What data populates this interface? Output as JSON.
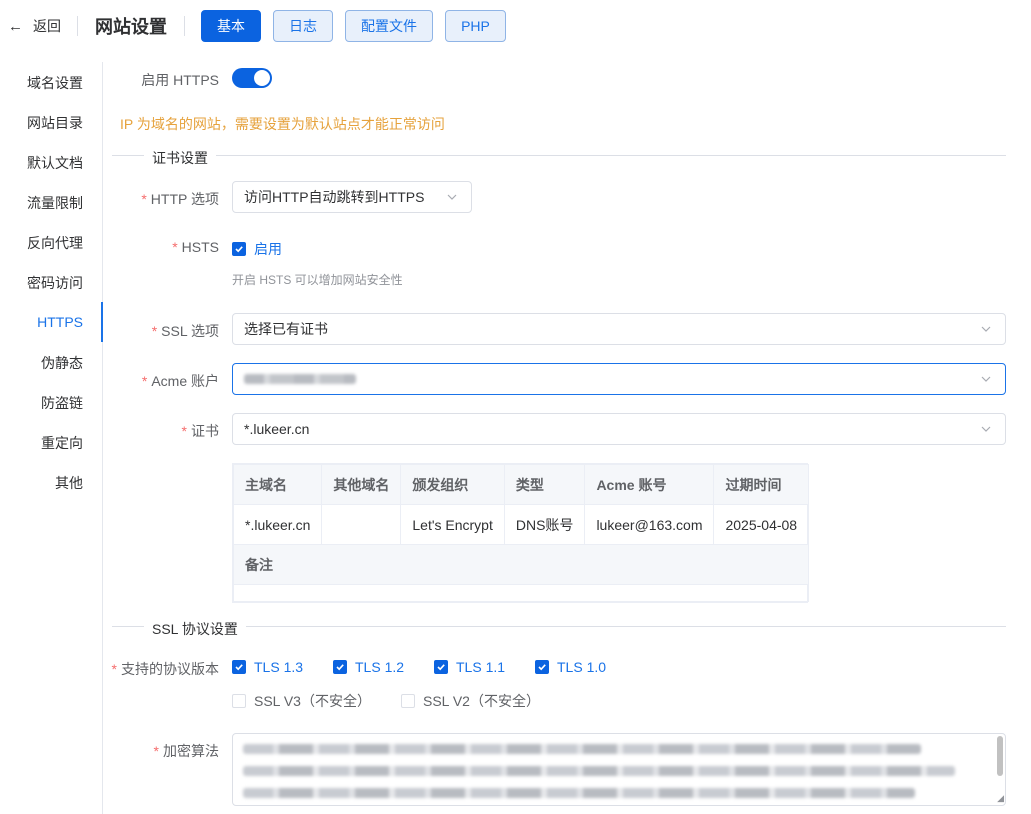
{
  "header": {
    "back_label": "返回",
    "title": "网站设置",
    "tabs": [
      {
        "label": "基本",
        "active": true
      },
      {
        "label": "日志",
        "active": false
      },
      {
        "label": "配置文件",
        "active": false
      },
      {
        "label": "PHP",
        "active": false
      }
    ]
  },
  "sidebar": {
    "items": [
      {
        "label": "域名设置"
      },
      {
        "label": "网站目录"
      },
      {
        "label": "默认文档"
      },
      {
        "label": "流量限制"
      },
      {
        "label": "反向代理"
      },
      {
        "label": "密码访问"
      },
      {
        "label": "HTTPS",
        "active": true
      },
      {
        "label": "伪静态"
      },
      {
        "label": "防盗链"
      },
      {
        "label": "重定向"
      },
      {
        "label": "其他"
      }
    ]
  },
  "https": {
    "enable_label": "启用 HTTPS",
    "enabled": true,
    "warning": "IP 为域名的网站，需要设置为默认站点才能正常访问"
  },
  "cert_section": {
    "title": "证书设置",
    "http_option": {
      "label": "HTTP 选项",
      "value": "访问HTTP自动跳转到HTTPS"
    },
    "hsts": {
      "label": "HSTS",
      "checkbox_label": "启用",
      "checked": true,
      "hint": "开启 HSTS 可以增加网站安全性"
    },
    "ssl_option": {
      "label": "SSL 选项",
      "value": "选择已有证书"
    },
    "acme_account": {
      "label": "Acme 账户"
    },
    "cert": {
      "label": "证书",
      "value": "*.lukeer.cn"
    },
    "table": {
      "headers": [
        "主域名",
        "其他域名",
        "颁发组织",
        "类型",
        "Acme 账号",
        "过期时间"
      ],
      "row": [
        "*.lukeer.cn",
        "",
        "Let's Encrypt",
        "DNS账号",
        "lukeer@163.com",
        "2025-04-08"
      ],
      "note_label": "备注"
    }
  },
  "ssl_section": {
    "title": "SSL 协议设置",
    "protocols_label": "支持的协议版本",
    "protocols": [
      {
        "label": "TLS 1.3",
        "checked": true
      },
      {
        "label": "TLS 1.2",
        "checked": true
      },
      {
        "label": "TLS 1.1",
        "checked": true
      },
      {
        "label": "TLS 1.0",
        "checked": true
      },
      {
        "label": "SSL V3（不安全）",
        "checked": false
      },
      {
        "label": "SSL V2（不安全）",
        "checked": false
      }
    ],
    "cipher_label": "加密算法"
  },
  "colors": {
    "primary": "#0b63e0",
    "warning": "#e6a23c",
    "required": "#f56c6c"
  }
}
